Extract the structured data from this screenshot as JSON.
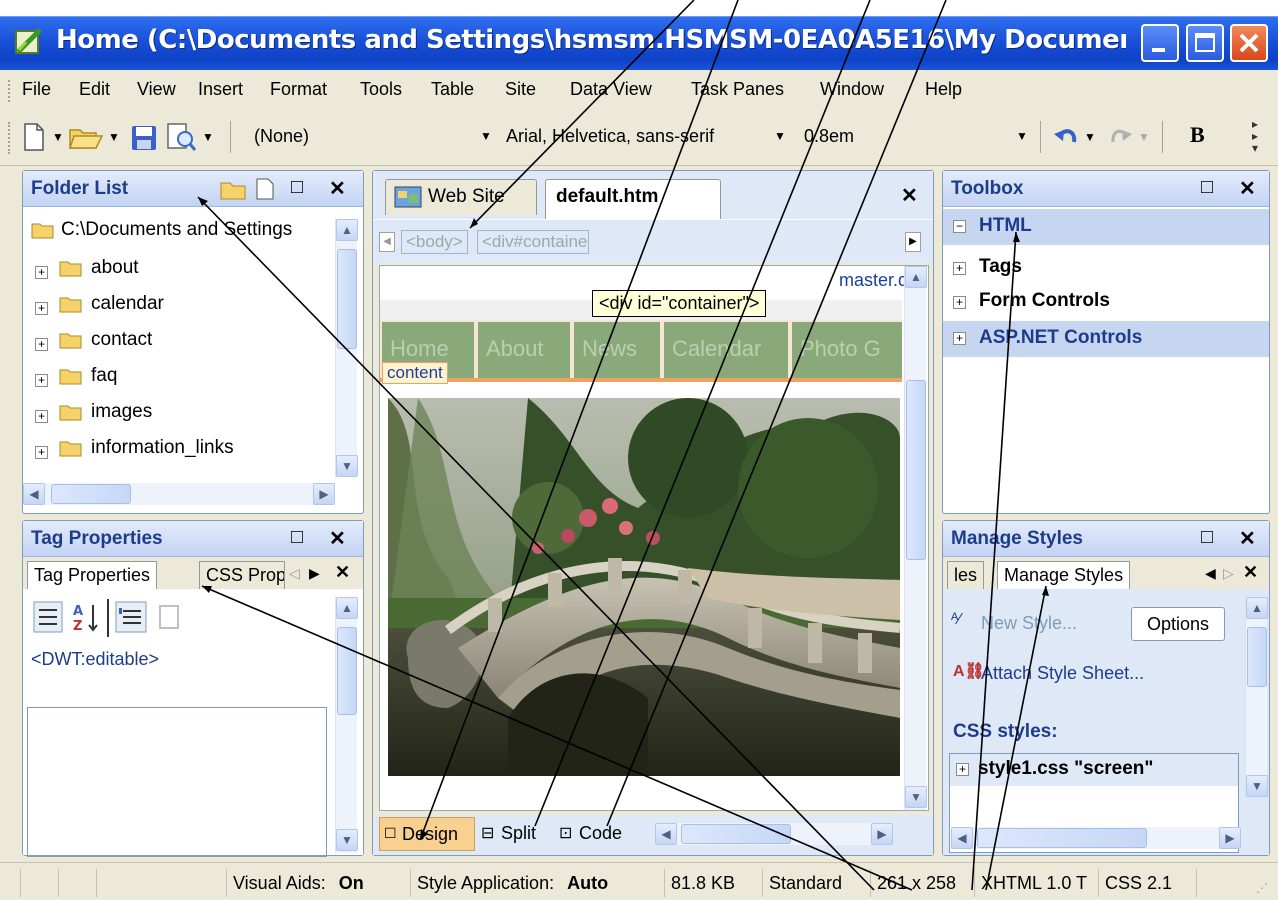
{
  "window": {
    "title": "Home (C:\\Documents and Settings\\hsmsm.HSMSM-0EA0A5E16\\My Documents\\My We..."
  },
  "menu": [
    "File",
    "Edit",
    "View",
    "Insert",
    "Format",
    "Tools",
    "Table",
    "Site",
    "Data View",
    "Task Panes",
    "Window",
    "Help"
  ],
  "toolbar": {
    "style": "(None)",
    "font": "Arial, Helvetica, sans-serif",
    "size": "0.8em",
    "bold": "B"
  },
  "folder_list": {
    "title": "Folder List",
    "root": "C:\\Documents and Settings",
    "items": [
      "about",
      "calendar",
      "contact",
      "faq",
      "images",
      "information_links"
    ]
  },
  "tag_properties": {
    "title": "Tag Properties",
    "tabs": [
      "Tag Properties",
      "CSS Prop"
    ],
    "tag": "<DWT:editable>"
  },
  "editor": {
    "tabs": [
      "Web Site",
      "default.htm"
    ],
    "breadcrumb": [
      "<body>",
      "<div#container>"
    ],
    "template": "master.dwt",
    "tooltip": "<div id=\"container\">",
    "nav": [
      "Home",
      "About",
      "News",
      "Calendar",
      "Photo G"
    ],
    "region_label": "content",
    "view_tabs": [
      "Design",
      "Split",
      "Code"
    ]
  },
  "toolbox": {
    "title": "Toolbox",
    "sections": [
      "HTML",
      "Tags",
      "Form Controls",
      "ASP.NET Controls"
    ]
  },
  "manage_styles": {
    "title": "Manage Styles",
    "tabs": [
      "les",
      "Manage Styles"
    ],
    "new_style": "New Style...",
    "options": "Options",
    "attach": "Attach Style Sheet...",
    "css_heading": "CSS styles:",
    "stylesheet": "style1.css \"screen\""
  },
  "status": {
    "visual_aids_label": "Visual Aids:",
    "visual_aids_value": "On",
    "style_app_label": "Style Application:",
    "style_app_value": "Auto",
    "size": "81.8 KB",
    "mode": "Standard",
    "dimensions": "261 x 258",
    "doctype": "XHTML 1.0 T",
    "css": "CSS 2.1"
  },
  "colors": {
    "titlebar": "#1a50d8",
    "pane_title": "#1e3c8c",
    "nav_green": "#8aa97b",
    "chrome": "#ece9d8"
  }
}
